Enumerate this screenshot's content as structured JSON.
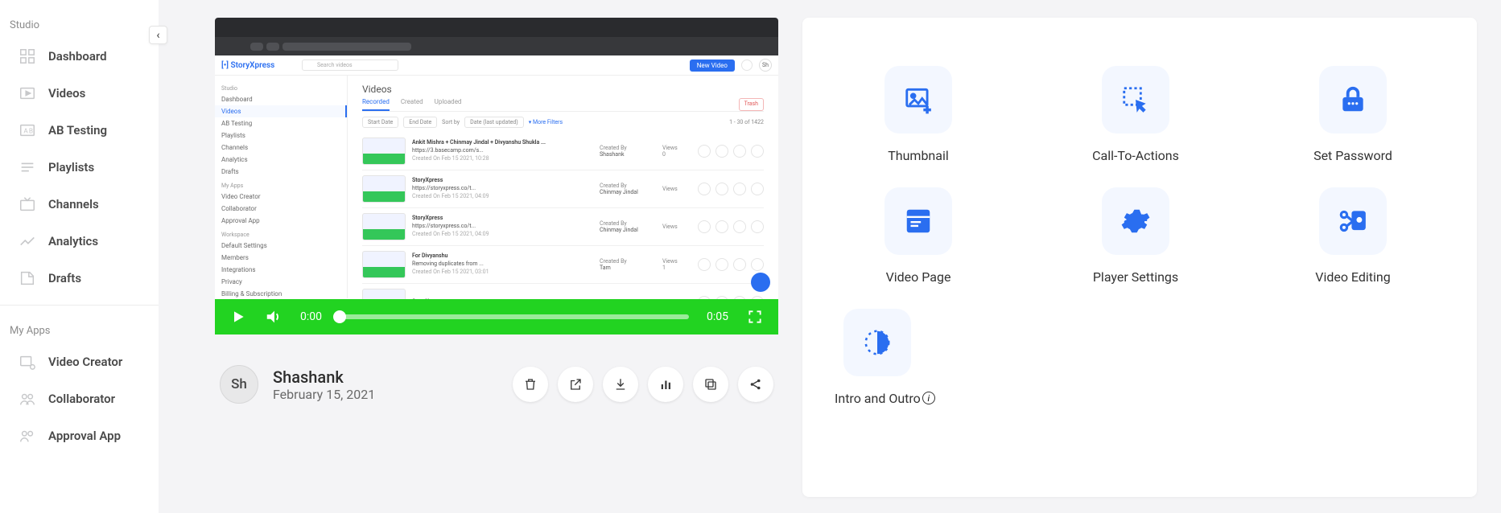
{
  "sidebar": {
    "sections": [
      {
        "title": "Studio",
        "items": [
          {
            "label": "Dashboard",
            "icon": "dashboard"
          },
          {
            "label": "Videos",
            "icon": "videos"
          },
          {
            "label": "AB Testing",
            "icon": "ab"
          },
          {
            "label": "Playlists",
            "icon": "playlist"
          },
          {
            "label": "Channels",
            "icon": "tv"
          },
          {
            "label": "Analytics",
            "icon": "analytics"
          },
          {
            "label": "Drafts",
            "icon": "drafts"
          }
        ]
      },
      {
        "title": "My Apps",
        "items": [
          {
            "label": "Video Creator",
            "icon": "creator"
          },
          {
            "label": "Collaborator",
            "icon": "collab"
          },
          {
            "label": "Approval App",
            "icon": "approval"
          }
        ]
      }
    ]
  },
  "video": {
    "player": {
      "current_time": "0:00",
      "duration": "0:05"
    },
    "mini": {
      "logo": "[•] StoryXpress",
      "search_placeholder": "Search videos",
      "new_button": "New Video",
      "avatar": "Sh",
      "studio_label": "Studio",
      "items": [
        "Dashboard",
        "Videos",
        "AB Testing",
        "Playlists",
        "Channels",
        "Analytics",
        "Drafts"
      ],
      "myapps_label": "My Apps",
      "apps": [
        "Video Creator",
        "Collaborator",
        "Approval App"
      ],
      "workspace_label": "Workspace",
      "workspace": [
        "Default Settings",
        "Members",
        "Integrations",
        "Privacy",
        "Billing & Subscription"
      ],
      "page_title": "Videos",
      "tabs": [
        "Recorded",
        "Created",
        "Uploaded"
      ],
      "trash": "Trash",
      "filters": {
        "start": "Start Date",
        "end": "End Date",
        "sort_label": "Sort by",
        "sort": "Date (last updated)",
        "more": "More Filters"
      },
      "range": "1 - 30 of 1422",
      "rows": [
        {
          "title": "Ankit Mishra + Chinmay Jindal + Divyanshu Shukla ...",
          "sub": "https://3.basecamp.com/s...",
          "created": "Created On Feb 15 2021, 10:28",
          "by": "Shashank",
          "views": "0"
        },
        {
          "title": "StoryXpress",
          "sub": "https://storyxpress.co/t...",
          "created": "Created On Feb 15 2021, 04:09",
          "by": "Chinmay Jindal",
          "views": ""
        },
        {
          "title": "StoryXpress",
          "sub": "https://storyxpress.co/t...",
          "created": "Created On Feb 15 2021, 04:09",
          "by": "Chinmay Jindal",
          "views": ""
        },
        {
          "title": "For Divyanshu",
          "sub": "Removing duplicates from ...",
          "created": "Created On Feb 15 2021, 03:01",
          "by": "Tam",
          "views": "1"
        },
        {
          "title": "StoryXpress",
          "sub": "",
          "created": "",
          "by": "",
          "views": ""
        }
      ],
      "created_by_label": "Created By",
      "views_label": "Views"
    }
  },
  "author": {
    "initials": "Sh",
    "name": "Shashank",
    "date": "February 15, 2021"
  },
  "panel": {
    "items": [
      {
        "label": "Thumbnail",
        "icon": "thumbnail"
      },
      {
        "label": "Call-To-Actions",
        "icon": "cta"
      },
      {
        "label": "Set Password",
        "icon": "lock"
      },
      {
        "label": "Video Page",
        "icon": "page"
      },
      {
        "label": "Player Settings",
        "icon": "gear"
      },
      {
        "label": "Video Editing",
        "icon": "scissors"
      },
      {
        "label": "Intro and Outro",
        "icon": "timer",
        "info": true
      }
    ]
  }
}
